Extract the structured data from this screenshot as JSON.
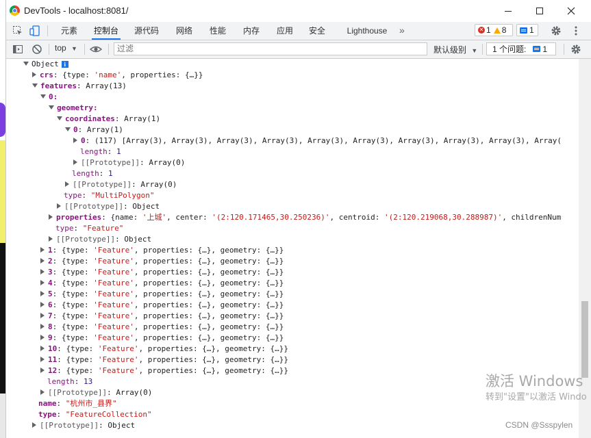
{
  "window": {
    "title": "DevTools - localhost:8081/"
  },
  "tabs": [
    {
      "label": "元素"
    },
    {
      "label": "控制台"
    },
    {
      "label": "源代码"
    },
    {
      "label": "网络"
    },
    {
      "label": "性能"
    },
    {
      "label": "内存"
    },
    {
      "label": "应用"
    },
    {
      "label": "安全"
    },
    {
      "label": "Lighthouse"
    }
  ],
  "tabbar_badges": {
    "errors": "1",
    "warnings": "8",
    "messages": "1"
  },
  "console_toolbar": {
    "context": "top",
    "filter_placeholder": "过滤",
    "log_level": "默认级别",
    "issues_label": "1 个问题:",
    "issues_count": "1"
  },
  "tree": {
    "root": "Object",
    "crs": {
      "key": "crs",
      "value_pre": "{type: ",
      "type": "'name'",
      "value_post": ", properties: {…}}"
    },
    "features": {
      "key": "features",
      "value": "Array(13)"
    },
    "f0": {
      "index": "0:"
    },
    "geometry": {
      "key": "geometry:"
    },
    "coordinates": {
      "key": "coordinates",
      "value": "Array(1)"
    },
    "coord0": {
      "key": "0",
      "value": "Array(1)"
    },
    "coord00": {
      "key": "0",
      "value": "(117) [Array(3), Array(3), Array(3), Array(3), Array(3), Array(3), Array(3), Array(3), Array(3), Array("
    },
    "len1": {
      "key": "length",
      "value": "1"
    },
    "proto_arr0_a": {
      "key": "[[Prototype]]",
      "value": "Array(0)"
    },
    "len1b": {
      "key": "length",
      "value": "1"
    },
    "proto_arr0_b": {
      "key": "[[Prototype]]",
      "value": "Array(0)"
    },
    "geom_type": {
      "key": "type",
      "value": "\"MultiPolygon\""
    },
    "proto_obj_a": {
      "key": "[[Prototype]]",
      "value": "Object"
    },
    "properties": {
      "key": "properties",
      "pre": "{name: ",
      "name": "'上城'",
      "mid1": ", center: ",
      "center": "'(2:120.171465,30.250236)'",
      "mid2": ", centroid: ",
      "centroid": "'(2:120.219068,30.288987)'",
      "post": ", childrenNum"
    },
    "f_type": {
      "key": "type",
      "value": "\"Feature\""
    },
    "proto_obj_b": {
      "key": "[[Prototype]]",
      "value": "Object"
    },
    "features_rest": [
      {
        "idx": "1"
      },
      {
        "idx": "2"
      },
      {
        "idx": "3"
      },
      {
        "idx": "4"
      },
      {
        "idx": "5"
      },
      {
        "idx": "6"
      },
      {
        "idx": "7"
      },
      {
        "idx": "8"
      },
      {
        "idx": "9"
      },
      {
        "idx": "10"
      },
      {
        "idx": "11"
      },
      {
        "idx": "12"
      }
    ],
    "feature_summary": {
      "pre": "{type: ",
      "type": "'Feature'",
      "post": ", properties: {…}, geometry: {…}}"
    },
    "features_len": {
      "key": "length",
      "value": "13"
    },
    "proto_arr0_c": {
      "key": "[[Prototype]]",
      "value": "Array(0)"
    },
    "name": {
      "key": "name",
      "value": "\"杭州市_县界\""
    },
    "root_type": {
      "key": "type",
      "value": "\"FeatureCollection\""
    },
    "proto_obj_c": {
      "key": "[[Prototype]]",
      "value": "Object"
    }
  },
  "watermark": {
    "activate_title": "激活 Windows",
    "activate_sub": "转到\"设置\"以激活 Windo",
    "csdn": "CSDN @Ssspylen"
  },
  "colors": {
    "key": "#881280",
    "string": "#c41a16",
    "number": "#1a1aa6",
    "accent": "#1a73e8"
  }
}
